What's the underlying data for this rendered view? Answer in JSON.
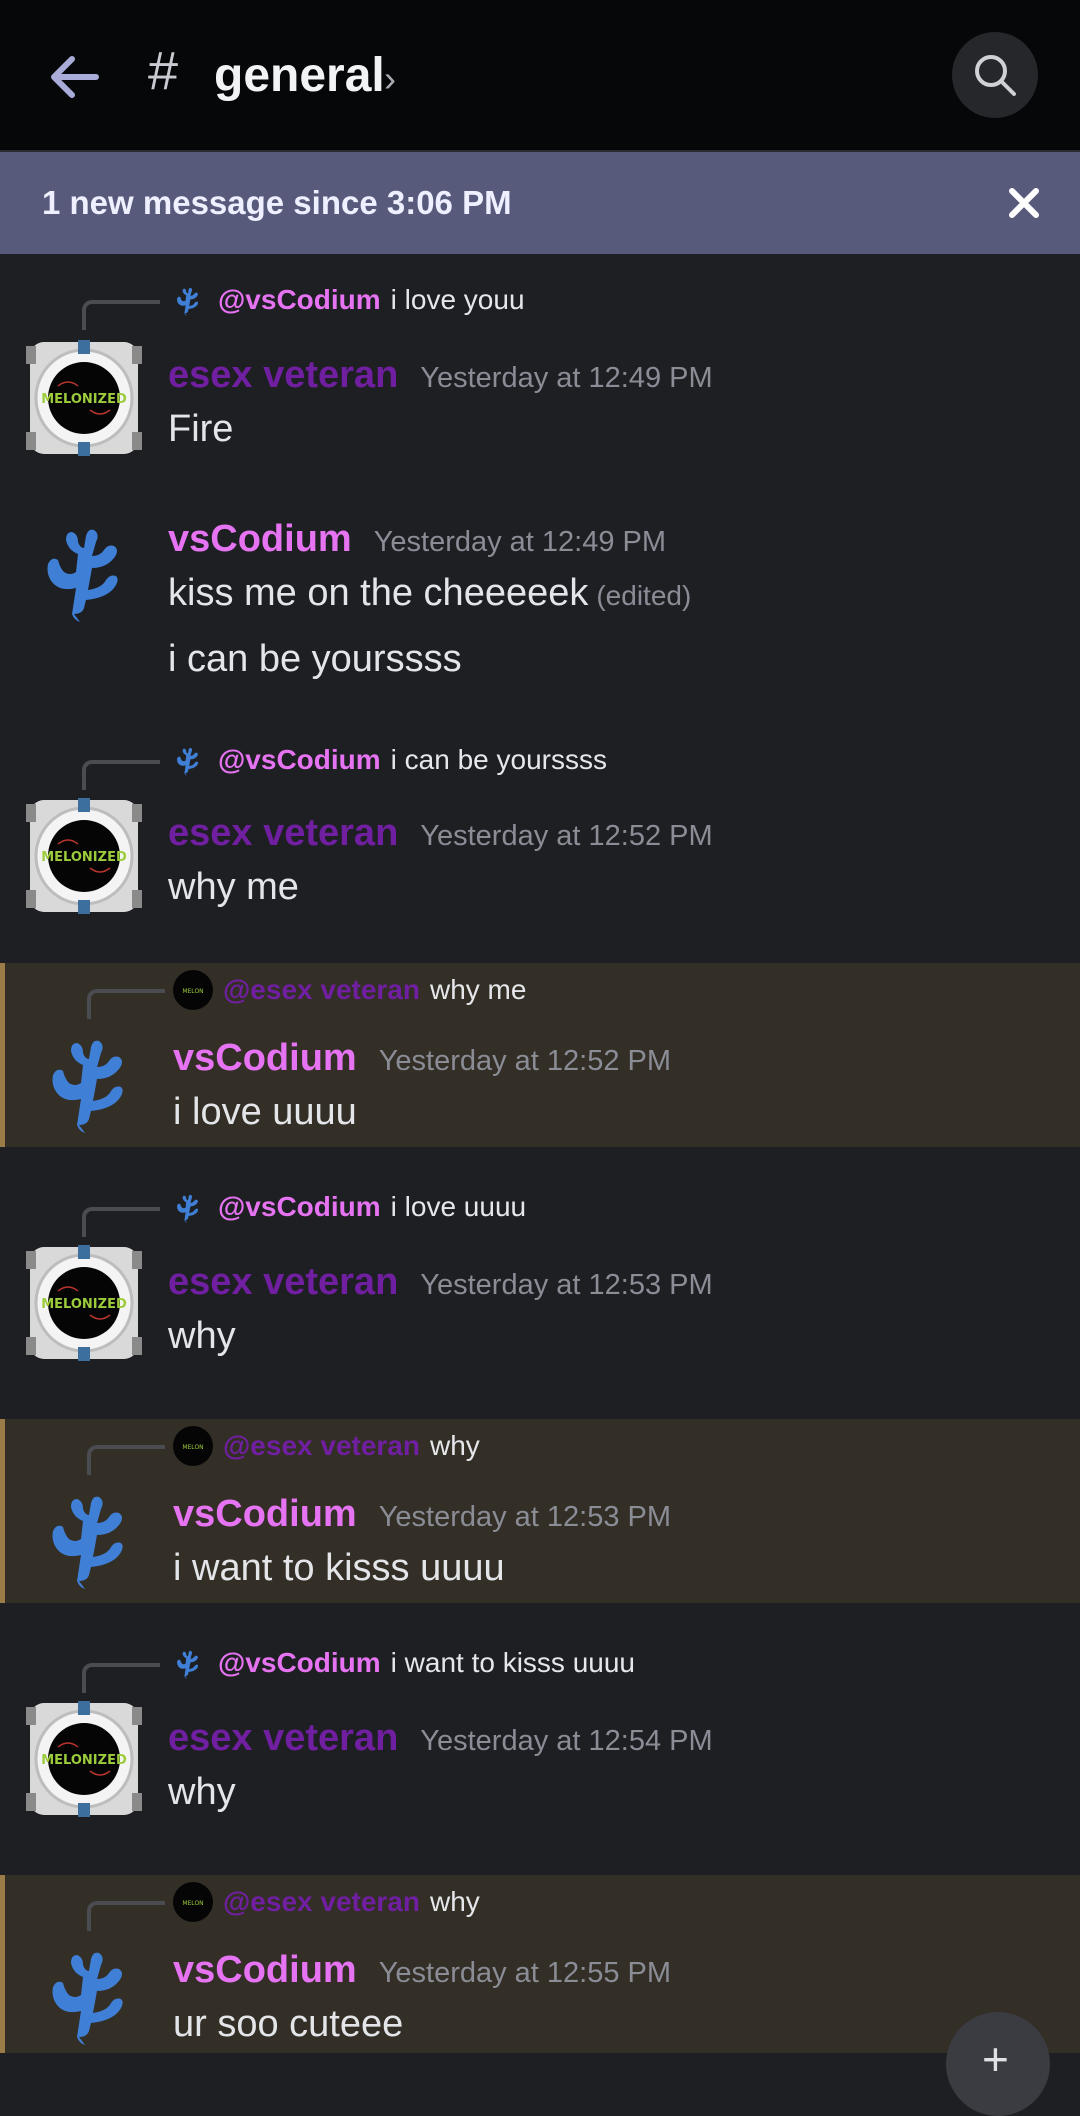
{
  "header": {
    "channel_name": "general",
    "hash_symbol": "#",
    "chevron": "›",
    "back_icon": "arrow-left-icon",
    "search_icon": "search-icon"
  },
  "banner": {
    "text": "1 new message since 3:06 PM",
    "close_icon": "close-icon"
  },
  "colors": {
    "esex_name": "#6f1fa0",
    "vs_name": "#e673f2",
    "highlight_bg": "#332e26",
    "highlight_border": "#9b7b48",
    "banner_bg": "#585a7c"
  },
  "messages": [
    {
      "author": "esex veteran",
      "time": "Yesterday at 12:49 PM",
      "reply_to": "@vsCodium",
      "reply_text": "i love youu",
      "lines": [
        "Fire"
      ]
    },
    {
      "author": "vsCodium",
      "time": "Yesterday at 12:49 PM",
      "lines": [
        "kiss me on the cheeeeek",
        "i can be yourssss"
      ],
      "edited_label": "(edited)"
    },
    {
      "author": "esex veteran",
      "time": "Yesterday at 12:52 PM",
      "reply_to": "@vsCodium",
      "reply_text": "i can be yourssss",
      "lines": [
        "why me"
      ]
    },
    {
      "author": "vsCodium",
      "time": "Yesterday at 12:52 PM",
      "reply_to": "@esex veteran",
      "reply_text": "why me",
      "lines": [
        "i love uuuu"
      ],
      "highlighted": true
    },
    {
      "author": "esex veteran",
      "time": "Yesterday at 12:53 PM",
      "reply_to": "@vsCodium",
      "reply_text": "i love uuuu",
      "lines": [
        "why"
      ]
    },
    {
      "author": "vsCodium",
      "time": "Yesterday at 12:53 PM",
      "reply_to": "@esex veteran",
      "reply_text": "why",
      "lines": [
        "i want to kisss uuuu"
      ],
      "highlighted": true
    },
    {
      "author": "esex veteran",
      "time": "Yesterday at 12:54 PM",
      "reply_to": "@vsCodium",
      "reply_text": "i want to kisss uuuu",
      "lines": [
        "why"
      ]
    },
    {
      "author": "vsCodium",
      "time": "Yesterday at 12:55 PM",
      "reply_to": "@esex veteran",
      "reply_text": "why",
      "lines": [
        "ur soo cuteee"
      ],
      "highlighted": true
    }
  ],
  "fab": {
    "label": "+"
  }
}
